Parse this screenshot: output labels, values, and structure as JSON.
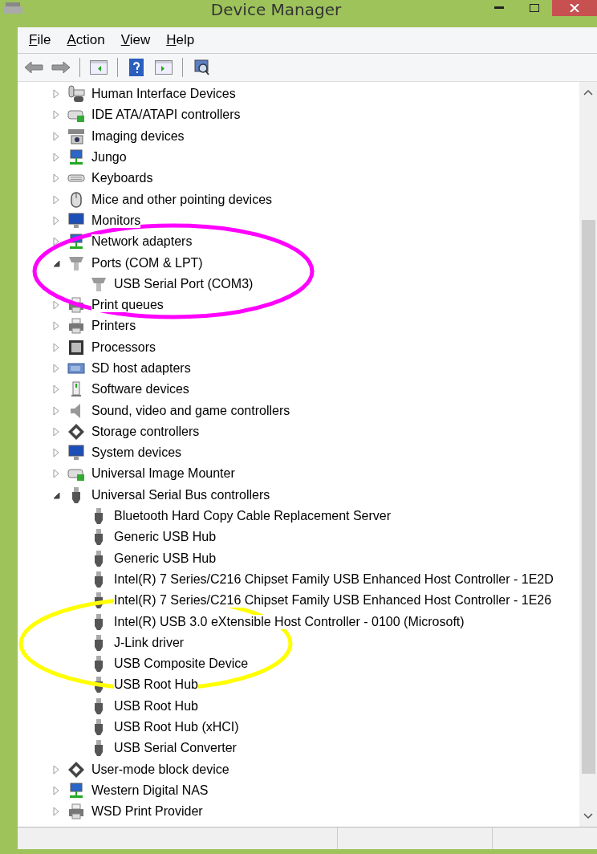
{
  "window": {
    "title": "Device Manager"
  },
  "menu": [
    {
      "label": "File"
    },
    {
      "label": "Action"
    },
    {
      "label": "View"
    },
    {
      "label": "Help"
    }
  ],
  "tree": [
    {
      "label": "Human Interface Devices",
      "kind": "hid",
      "expanded": false
    },
    {
      "label": "IDE ATA/ATAPI controllers",
      "kind": "disk",
      "expanded": false
    },
    {
      "label": "Imaging devices",
      "kind": "camera",
      "expanded": false
    },
    {
      "label": "Jungo",
      "kind": "network",
      "expanded": false
    },
    {
      "label": "Keyboards",
      "kind": "keyboard",
      "expanded": false
    },
    {
      "label": "Mice and other pointing devices",
      "kind": "mouse",
      "expanded": false
    },
    {
      "label": "Monitors",
      "kind": "monitor",
      "expanded": false
    },
    {
      "label": "Network adapters",
      "kind": "network",
      "expanded": false
    },
    {
      "label": "Ports (COM & LPT)",
      "kind": "port",
      "expanded": true,
      "children": [
        {
          "label": "USB Serial Port (COM3)",
          "kind": "port"
        }
      ]
    },
    {
      "label": "Print queues",
      "kind": "printer",
      "expanded": false
    },
    {
      "label": "Printers",
      "kind": "printer",
      "expanded": false
    },
    {
      "label": "Processors",
      "kind": "chip",
      "expanded": false
    },
    {
      "label": "SD host adapters",
      "kind": "card",
      "expanded": false
    },
    {
      "label": "Software devices",
      "kind": "software",
      "expanded": false
    },
    {
      "label": "Sound, video and game controllers",
      "kind": "speaker",
      "expanded": false
    },
    {
      "label": "Storage controllers",
      "kind": "storage",
      "expanded": false
    },
    {
      "label": "System devices",
      "kind": "monitor",
      "expanded": false
    },
    {
      "label": "Universal Image Mounter",
      "kind": "disk",
      "expanded": false
    },
    {
      "label": "Universal Serial Bus controllers",
      "kind": "usb",
      "expanded": true,
      "children": [
        {
          "label": "Bluetooth Hard Copy Cable Replacement Server",
          "kind": "usb"
        },
        {
          "label": "Generic USB Hub",
          "kind": "usb"
        },
        {
          "label": "Generic USB Hub",
          "kind": "usb"
        },
        {
          "label": "Intel(R) 7 Series/C216 Chipset Family USB Enhanced Host Controller - 1E2D",
          "kind": "usb"
        },
        {
          "label": "Intel(R) 7 Series/C216 Chipset Family USB Enhanced Host Controller - 1E26",
          "kind": "usb"
        },
        {
          "label": "Intel(R) USB 3.0 eXtensible Host Controller - 0100 (Microsoft)",
          "kind": "usb"
        },
        {
          "label": "J-Link driver",
          "kind": "usb"
        },
        {
          "label": "USB Composite Device",
          "kind": "usb"
        },
        {
          "label": "USB Root Hub",
          "kind": "usb"
        },
        {
          "label": "USB Root Hub",
          "kind": "usb"
        },
        {
          "label": "USB Root Hub (xHCI)",
          "kind": "usb"
        },
        {
          "label": "USB Serial Converter",
          "kind": "usb"
        }
      ]
    },
    {
      "label": "User-mode block device",
      "kind": "storage",
      "expanded": false
    },
    {
      "label": "Western Digital NAS",
      "kind": "network",
      "expanded": false
    },
    {
      "label": "WSD Print Provider",
      "kind": "printer",
      "expanded": false
    }
  ],
  "annotations": [
    {
      "color": "#ff00ff"
    },
    {
      "color": "#ffff00"
    }
  ]
}
